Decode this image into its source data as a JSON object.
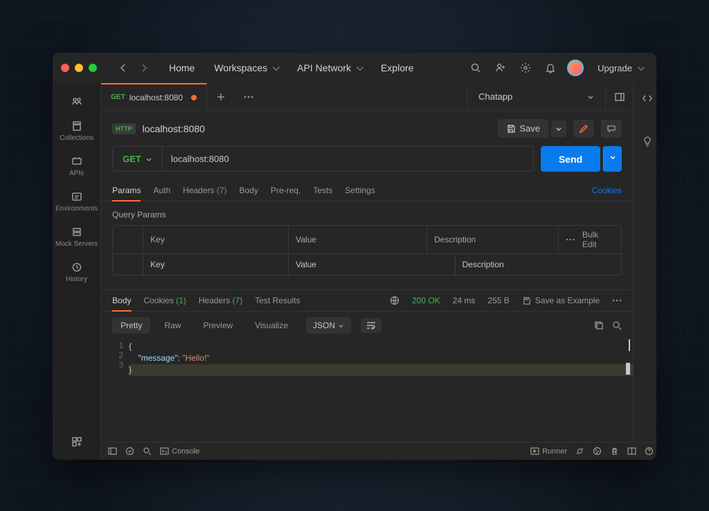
{
  "nav": {
    "home": "Home",
    "workspaces": "Workspaces",
    "api_network": "API Network",
    "explore": "Explore",
    "upgrade": "Upgrade"
  },
  "sidebar": {
    "collections": "Collections",
    "apis": "APIs",
    "environments": "Environments",
    "mock_servers": "Mock Servers",
    "history": "History"
  },
  "tab": {
    "method": "GET",
    "url": "localhost:8080"
  },
  "environment": {
    "name": "Chatapp"
  },
  "request": {
    "badge": "HTTP",
    "title": "localhost:8080",
    "save": "Save",
    "verb": "GET",
    "url": "localhost:8080",
    "send": "Send"
  },
  "req_tabs": {
    "params": "Params",
    "auth": "Auth",
    "headers": "Headers",
    "headers_count": "(7)",
    "body": "Body",
    "prereq": "Pre-req.",
    "tests": "Tests",
    "settings": "Settings",
    "cookies": "Cookies"
  },
  "query_params": {
    "title": "Query Params",
    "columns": {
      "key": "Key",
      "value": "Value",
      "description": "Description"
    },
    "bulk_edit": "Bulk Edit",
    "placeholders": {
      "key": "Key",
      "value": "Value",
      "description": "Description"
    }
  },
  "resp_tabs": {
    "body": "Body",
    "cookies": "Cookies",
    "cookies_count": "(1)",
    "headers": "Headers",
    "headers_count": "(7)",
    "test_results": "Test Results"
  },
  "status": {
    "code": "200 OK",
    "time": "24 ms",
    "size": "255 B",
    "save_example": "Save as Example"
  },
  "view_tabs": {
    "pretty": "Pretty",
    "raw": "Raw",
    "preview": "Preview",
    "visualize": "Visualize",
    "format": "JSON"
  },
  "code": {
    "l1": "{",
    "l2_indent": "    ",
    "l2_key": "\"message\"",
    "l2_colon": ": ",
    "l2_val": "\"Hello!\"",
    "l3": "}"
  },
  "line_numbers": {
    "l1": "1",
    "l2": "2",
    "l3": "3"
  },
  "statusbar": {
    "console": "Console",
    "runner": "Runner"
  }
}
